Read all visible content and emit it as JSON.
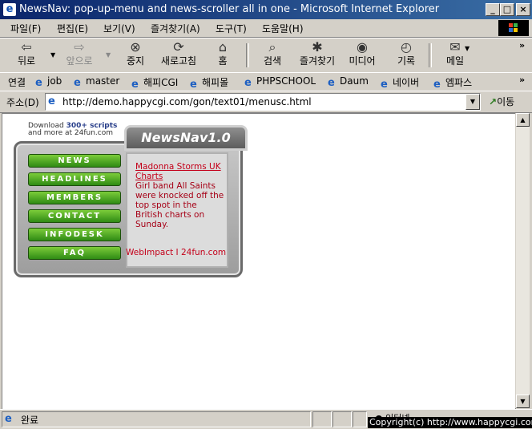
{
  "window": {
    "title": "NewsNav: pop-up-menu and news-scroller all in one - Microsoft Internet Explorer"
  },
  "menu": [
    "파일(F)",
    "편집(E)",
    "보기(V)",
    "즐겨찾기(A)",
    "도구(T)",
    "도움말(H)"
  ],
  "toolbar": {
    "back": "뒤로",
    "forward": "앞으로",
    "stop": "중지",
    "refresh": "새로고침",
    "home": "홈",
    "search": "검색",
    "favorites": "즐겨찾기",
    "media": "미디어",
    "history": "기록",
    "mail": "메일"
  },
  "links": {
    "label": "연결",
    "items": [
      "job",
      "master",
      "해피CGI",
      "해피몰",
      "PHPSCHOOL",
      "Daum",
      "네이버",
      "엠파스"
    ]
  },
  "address": {
    "label": "주소(D)",
    "url": "http://demo.happycgi.com/gon/text01/menusc.html",
    "go": "이동"
  },
  "page": {
    "download_prefix": "Download ",
    "download_bold": "300+ scripts",
    "download_line2": "and more at 24fun.com",
    "logo": "NewsNav1.0",
    "nav": [
      "NEWS",
      "HEADLINES",
      "MEMBERS",
      "CONTACT",
      "INFODESK",
      "FAQ"
    ],
    "news_headline": "Madonna Storms UK Charts",
    "news_body": "Girl band All Saints were knocked off the top spot in the British charts on Sunday.",
    "footer": "WebImpact  I  24fun.com"
  },
  "status": {
    "text": "완료",
    "zone": "인터넷"
  },
  "watermark": "Copyright(c) http://www.happycgi.com"
}
